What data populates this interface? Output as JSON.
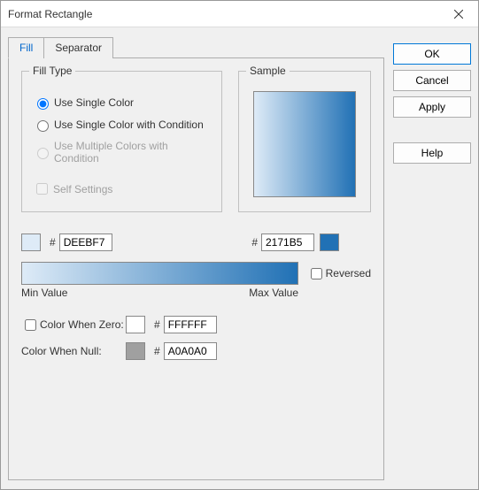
{
  "window": {
    "title": "Format Rectangle"
  },
  "tabs": {
    "fill": "Fill",
    "separator": "Separator"
  },
  "filltype": {
    "legend": "Fill Type",
    "single": "Use Single Color",
    "singlecond": "Use Single Color with Condition",
    "multicond": "Use Multiple Colors with Condition",
    "selfsettings": "Self Settings"
  },
  "sample": {
    "legend": "Sample"
  },
  "colors": {
    "start_hex": "DEEBF7",
    "end_hex": "2171B5",
    "start_swatch": "#DEEBF7",
    "end_swatch": "#2171B5"
  },
  "gradient": {
    "reversed_label": "Reversed",
    "min_label": "Min Value",
    "max_label": "Max Value"
  },
  "zero": {
    "label": "Color When Zero:",
    "swatch": "#FFFFFF",
    "hex": "FFFFFF"
  },
  "null": {
    "label": "Color When Null:",
    "swatch": "#A0A0A0",
    "hex": "A0A0A0"
  },
  "buttons": {
    "ok": "OK",
    "cancel": "Cancel",
    "apply": "Apply",
    "help": "Help"
  },
  "glyphs": {
    "hash": "#"
  }
}
